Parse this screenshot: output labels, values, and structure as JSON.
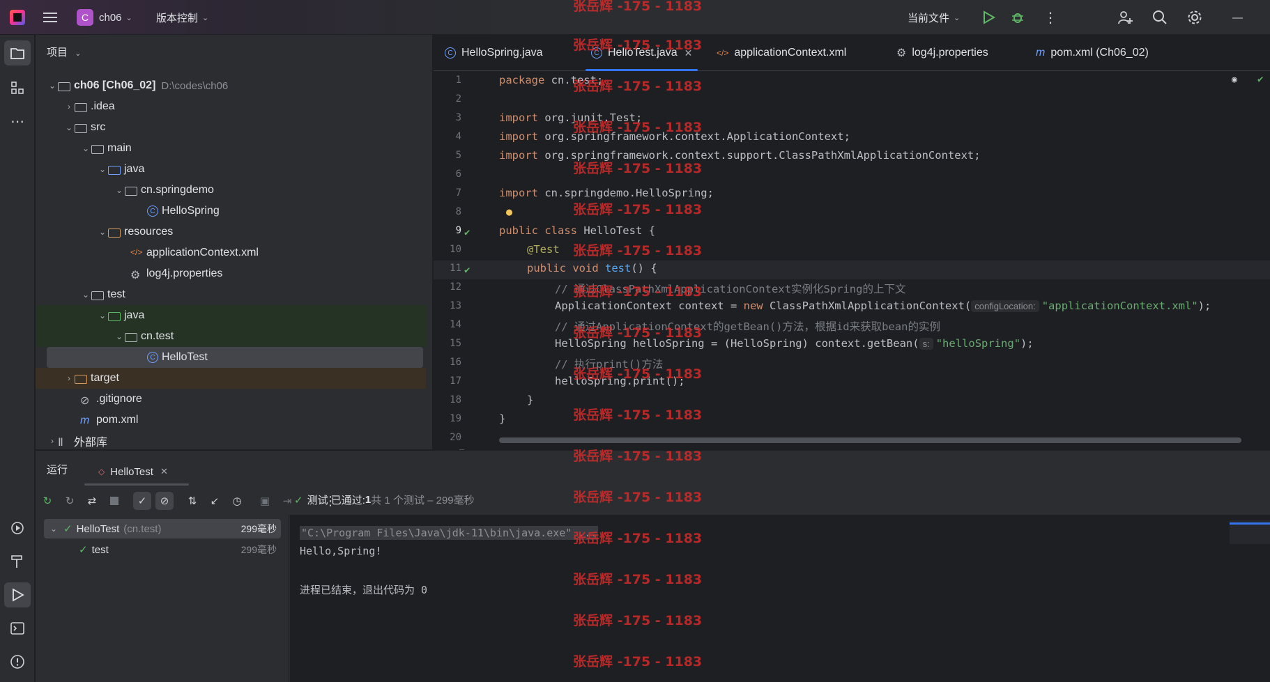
{
  "titlebar": {
    "project_badge": "C",
    "project_name": "ch06",
    "vcs_label": "版本控制",
    "run_config": "当前文件"
  },
  "project_panel": {
    "title": "项目",
    "tree": [
      {
        "label": "ch06 [Ch06_02]",
        "extra": "D:\\codes\\ch06"
      },
      {
        "label": ".idea"
      },
      {
        "label": "src"
      },
      {
        "label": "main"
      },
      {
        "label": "java"
      },
      {
        "label": "cn.springdemo"
      },
      {
        "label": "HelloSpring"
      },
      {
        "label": "resources"
      },
      {
        "label": "applicationContext.xml"
      },
      {
        "label": "log4j.properties"
      },
      {
        "label": "test"
      },
      {
        "label": "java"
      },
      {
        "label": "cn.test"
      },
      {
        "label": "HelloTest"
      },
      {
        "label": "target"
      },
      {
        "label": ".gitignore"
      },
      {
        "label": "pom.xml"
      },
      {
        "label": "外部库"
      }
    ]
  },
  "editor": {
    "tabs": [
      {
        "label": "HelloSpring.java"
      },
      {
        "label": "HelloTest.java"
      },
      {
        "label": "applicationContext.xml"
      },
      {
        "label": "log4j.properties"
      },
      {
        "label": "pom.xml (Ch06_02)"
      }
    ],
    "line_numbers": [
      "1",
      "2",
      "3",
      "4",
      "5",
      "6",
      "7",
      "8",
      "9",
      "10",
      "11",
      "12",
      "13",
      "14",
      "15",
      "16",
      "17",
      "18",
      "19",
      "20"
    ],
    "code": {
      "l1_kw": "package",
      "l1_rest": " cn.test;",
      "l3_kw": "import",
      "l3_rest": " org.junit.Test;",
      "l4_kw": "import",
      "l4_rest": " org.springframework.context.ApplicationContext;",
      "l5_kw": "import",
      "l5_rest": " org.springframework.context.support.ClassPathXmlApplicationContext;",
      "l7_kw": "import",
      "l7_rest": " cn.springdemo.HelloSpring;",
      "l9_kw": "public class",
      "l9_rest": " HelloTest {",
      "l10_ann": "@Test",
      "l11_kw": "public void",
      "l11_fn": " test",
      "l11_rest": "() {",
      "l12_cmt": "// 通过ClassPathXmlApplicationContext实例化Spring的上下文",
      "l13_a": "ApplicationContext context = ",
      "l13_kw": "new",
      "l13_b": " ClassPathXmlApplicationContext(",
      "l13_hint": "configLocation:",
      "l13_str": "\"applicationContext.xml\"",
      "l13_end": ");",
      "l14_cmt": "// 通过ApplicationContext的getBean()方法，根据id来获取bean的实例",
      "l15_a": "HelloSpring helloSpring = (HelloSpring) context.getBean(",
      "l15_hint": "s:",
      "l15_str": "\"helloSpring\"",
      "l15_end": ");",
      "l16_cmt": "// 执行print()方法",
      "l17": "helloSpring.print();",
      "l18": "}",
      "l19": "}"
    }
  },
  "run_panel": {
    "title": "运行",
    "tab_label": "HelloTest",
    "tests": [
      {
        "label": "HelloTest",
        "pkg": "(cn.test)",
        "time": "299毫秒"
      },
      {
        "label": "test",
        "time": "299毫秒"
      }
    ],
    "status_prefix": "测试 已通过: ",
    "status_count": "1",
    "status_suffix": "共 1 个测试 – 299毫秒",
    "console": [
      "\"C:\\Program Files\\Java\\jdk-11\\bin\\java.exe\" ...",
      "Hello,Spring!",
      "",
      "进程已结束，退出代码为 0"
    ]
  },
  "watermark": "张岳辉 -175 - 1183",
  "colors": {
    "accent": "#3574f0",
    "pass_green": "#5fb865",
    "keyword": "#cf8e6d",
    "string": "#6aab73",
    "watermark": "#d22b2b"
  }
}
